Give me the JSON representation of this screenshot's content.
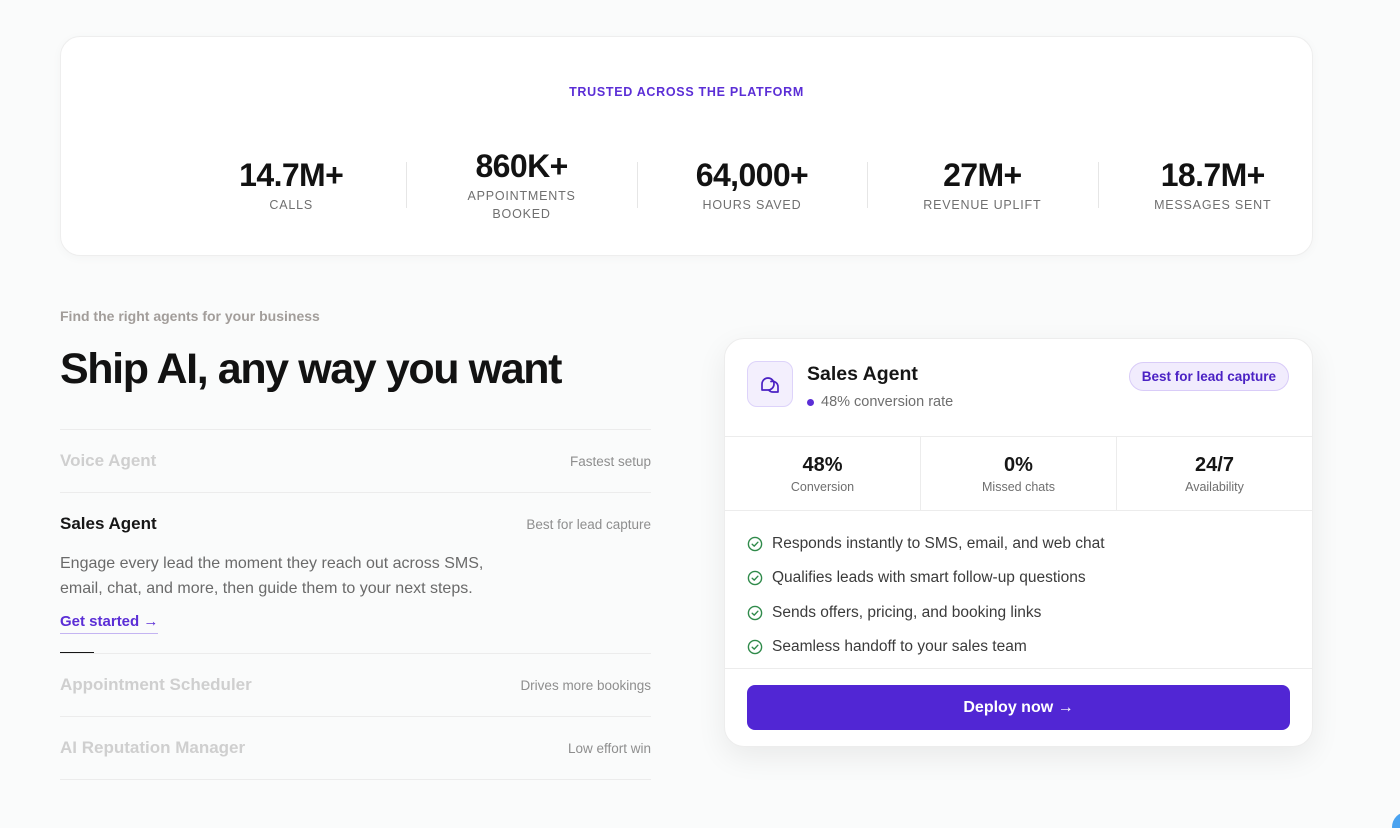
{
  "stats": {
    "eyebrow": "TRUSTED ACROSS THE PLATFORM",
    "items": [
      {
        "value": "14.7M+",
        "label": "CALLS"
      },
      {
        "value": "860K+",
        "label": "APPOINTMENTS BOOKED"
      },
      {
        "value": "64,000+",
        "label": "HOURS SAVED"
      },
      {
        "value": "27M+",
        "label": "REVENUE UPLIFT"
      },
      {
        "value": "18.7M+",
        "label": "MESSAGES SENT"
      }
    ]
  },
  "section": {
    "eyebrow": "Find the right agents for your business",
    "heading": "Ship AI, any way you want"
  },
  "agents": [
    {
      "name": "Voice Agent",
      "tag": "Fastest setup"
    },
    {
      "name": "Sales Agent",
      "tag": "Best for lead capture",
      "description": "Engage every lead the moment they reach out across SMS, email, chat, and more, then guide them to your next steps.",
      "cta": "Get started →"
    },
    {
      "name": "Appointment Scheduler",
      "tag": "Drives more bookings"
    },
    {
      "name": "AI Reputation Manager",
      "tag": "Low effort win"
    }
  ],
  "card": {
    "icon": "chat-bubbles-icon",
    "title": "Sales Agent",
    "subtitle": "48% conversion rate",
    "badge": "Best for lead capture",
    "metrics": [
      {
        "value": "48%",
        "label": "Conversion"
      },
      {
        "value": "0%",
        "label": "Missed chats"
      },
      {
        "value": "24/7",
        "label": "Availability"
      }
    ],
    "features": [
      "Responds instantly to SMS, email, and web chat",
      "Qualifies leads with smart follow-up questions",
      "Sends offers, pricing, and booking links",
      "Seamless handoff to your sales team"
    ],
    "deploy_label": "Deploy now →"
  },
  "colors": {
    "accent": "#5b2ed6",
    "button": "#5126d4",
    "check": "#2f8a4a"
  }
}
